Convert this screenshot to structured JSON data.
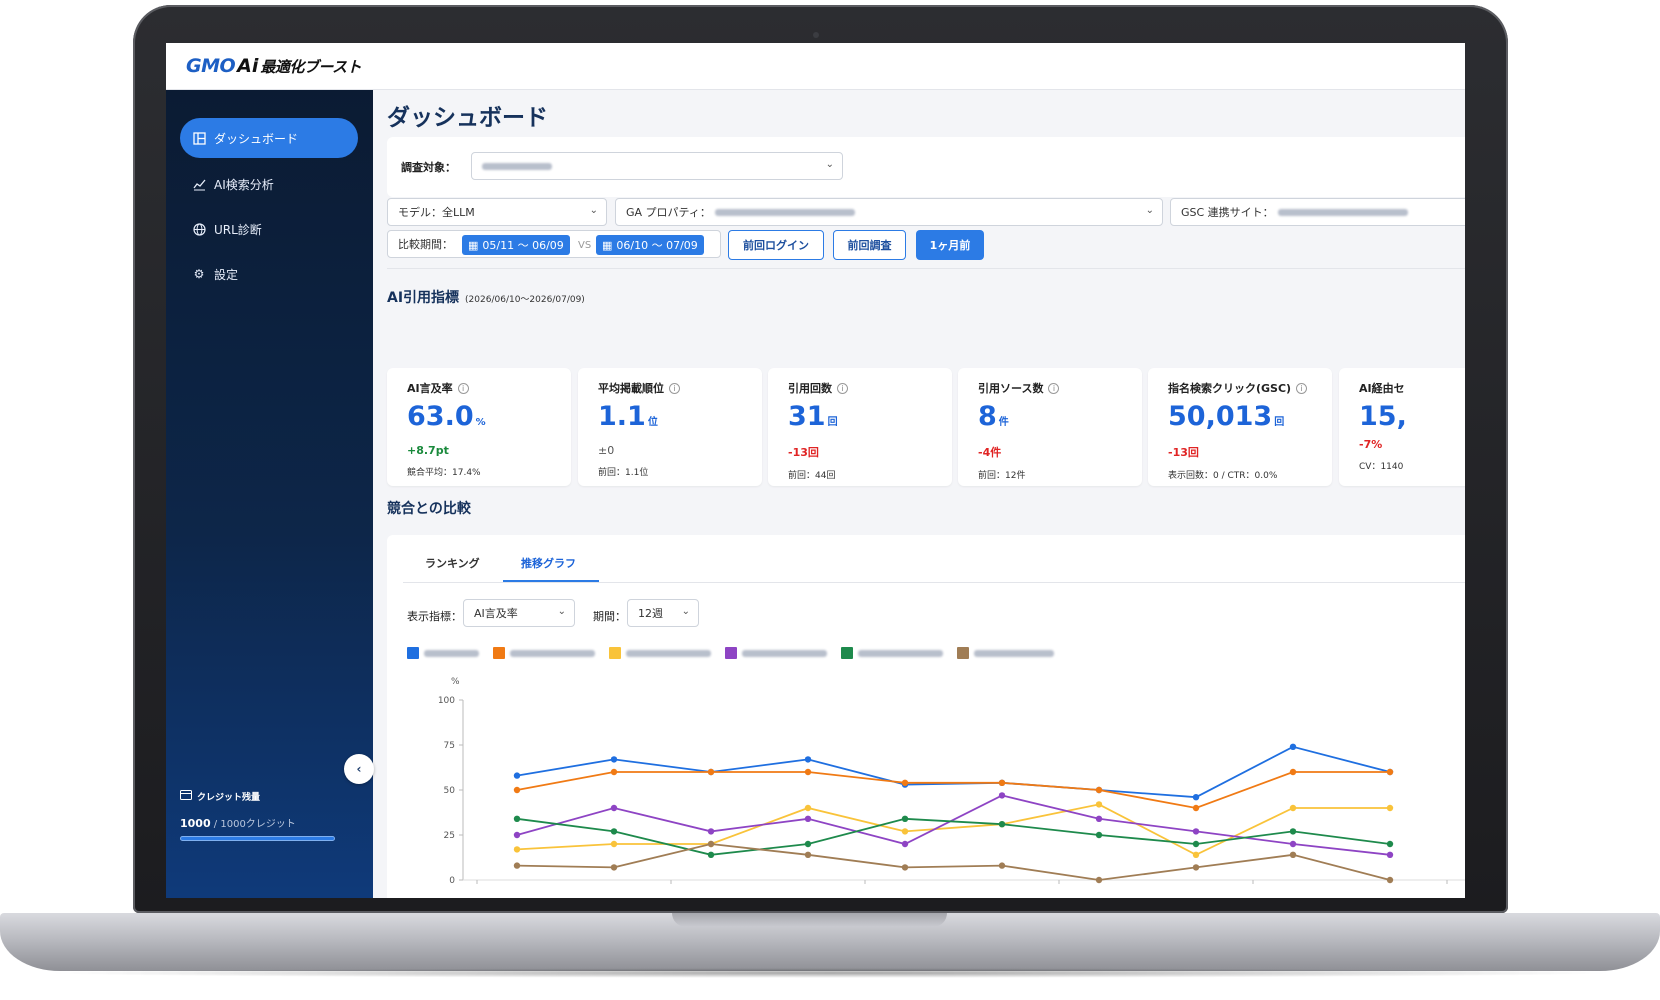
{
  "app": {
    "logo_gmo": "GMO",
    "logo_ai": "Ai",
    "logo_rest": "最適化ブースト"
  },
  "sidebar": {
    "items": [
      {
        "label": "ダッシュボード",
        "icon": "dashboard-icon"
      },
      {
        "label": "AI検索分析",
        "icon": "chart-icon"
      },
      {
        "label": "URL診断",
        "icon": "globe-icon"
      },
      {
        "label": "設定",
        "icon": "gear-icon"
      }
    ],
    "credit_title": "クレジット残量",
    "credit_value": "1000",
    "credit_total": " / 1000クレジット",
    "credit_ratio": 1.0
  },
  "page": {
    "title": "ダッシュボード"
  },
  "filters": {
    "target_label": "調査対象：",
    "model_value": "モデル：全LLM",
    "ga_label": "GA プロパティ：",
    "gsc_label": "GSC 連携サイト：",
    "period_label": "比較期間：",
    "range_a": "05/11 〜 06/09",
    "vs": "VS",
    "range_b": "06/10 〜 07/09",
    "btn_last_login": "前回ログイン",
    "btn_last_survey": "前回調査",
    "btn_one_month": "1ヶ月前"
  },
  "metrics": {
    "section_title": "AI引用指標",
    "section_range": "(2026/06/10〜2026/07/09)",
    "cards": [
      {
        "label": "AI言及率",
        "value": "63.0",
        "unit": "%",
        "delta": "+8.7pt",
        "trend": "up",
        "foot": "競合平均：17.4%"
      },
      {
        "label": "平均掲載順位",
        "value": "1.1",
        "unit": "位",
        "delta": "±0",
        "trend": "flat",
        "foot": "前回：1.1位"
      },
      {
        "label": "引用回数",
        "value": "31",
        "unit": "回",
        "delta": "-13回",
        "trend": "down",
        "foot": "前回：44回"
      },
      {
        "label": "引用ソース数",
        "value": "8",
        "unit": "件",
        "delta": "-4件",
        "trend": "down",
        "foot": "前回：12件"
      },
      {
        "label": "指名検索クリック(GSC)",
        "value": "50,013",
        "unit": "回",
        "delta": "-13回",
        "trend": "down",
        "foot": "表示回数：0 / CTR：0.0%"
      },
      {
        "label": "AI経由セ",
        "value": "15,",
        "unit": "",
        "delta": "-7%",
        "trend": "down",
        "foot": "CV：1140"
      }
    ]
  },
  "compare": {
    "section_title": "競合との比較",
    "tabs": [
      "ランキング",
      "推移グラフ"
    ],
    "metric_label": "表示指標：",
    "metric_value": "AI言及率",
    "period_label": "期間：",
    "period_value": "12週"
  },
  "colors": {
    "accent": "#2c7be5",
    "series": [
      "#1f6fe0",
      "#f07a14",
      "#f9c33a",
      "#8e44c4",
      "#1e8a4c",
      "#a07d55"
    ]
  },
  "chart_data": {
    "type": "line",
    "ylabel": "%",
    "ylim": [
      0,
      100
    ],
    "yticks": [
      0,
      25,
      50,
      75,
      100
    ],
    "grid": false,
    "series": [
      {
        "values": [
          58,
          67,
          60,
          67,
          53,
          54,
          50,
          46,
          74,
          60
        ]
      },
      {
        "values": [
          50,
          60,
          60,
          60,
          54,
          54,
          50,
          40,
          60,
          60
        ]
      },
      {
        "values": [
          17,
          20,
          20,
          40,
          27,
          31,
          42,
          14,
          40,
          40
        ]
      },
      {
        "values": [
          25,
          40,
          27,
          34,
          20,
          47,
          34,
          27,
          20,
          14
        ]
      },
      {
        "values": [
          34,
          27,
          14,
          20,
          34,
          31,
          25,
          20,
          27,
          20
        ]
      },
      {
        "values": [
          8,
          7,
          20,
          14,
          7,
          8,
          0,
          7,
          14,
          0
        ]
      }
    ]
  }
}
